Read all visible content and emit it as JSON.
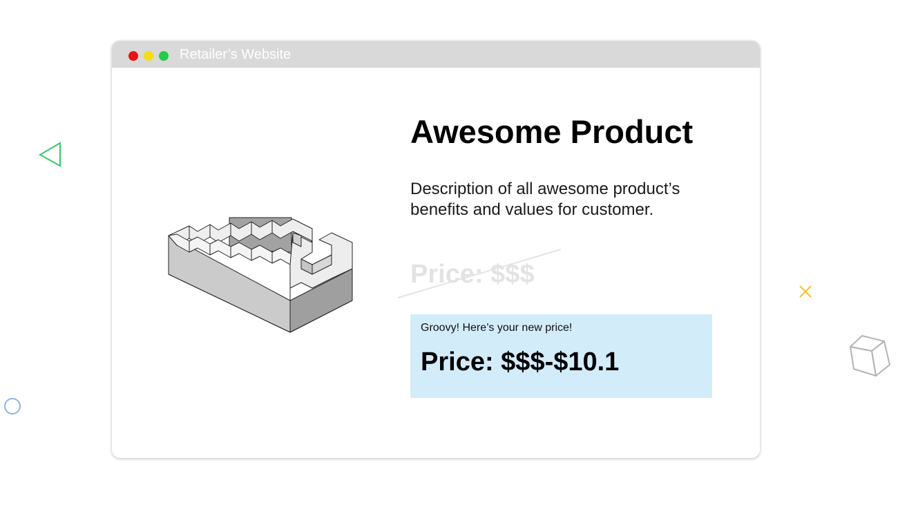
{
  "window": {
    "title": "Retailer’s Website",
    "controls": [
      {
        "name": "close",
        "color": "#ee1111"
      },
      {
        "name": "minimize",
        "color": "#f5dd0a"
      },
      {
        "name": "maximize",
        "color": "#22cc44"
      }
    ]
  },
  "product": {
    "name": "Awesome Product",
    "description": "Description of all awesome product’s benefits and values for customer.",
    "image_icon": "impossible-staircase-icon"
  },
  "pricing": {
    "old_price": "Price: $$$",
    "promo_message": "Groovy! Here’s your new price!",
    "new_price": "Price: $$$-$10.1"
  },
  "decorations": [
    {
      "icon": "triangle-outline-icon",
      "color": "#33cc66"
    },
    {
      "icon": "circle-outline-icon",
      "color": "#8fb3e6"
    },
    {
      "icon": "x-mark-icon",
      "color": "#f2c12e"
    },
    {
      "icon": "cube-outline-icon",
      "color": "#b3b3b3"
    }
  ],
  "colors": {
    "title_bar": "#d9d9d9",
    "price_box": "#d2ecfa",
    "old_price": "#e3e3e3"
  }
}
